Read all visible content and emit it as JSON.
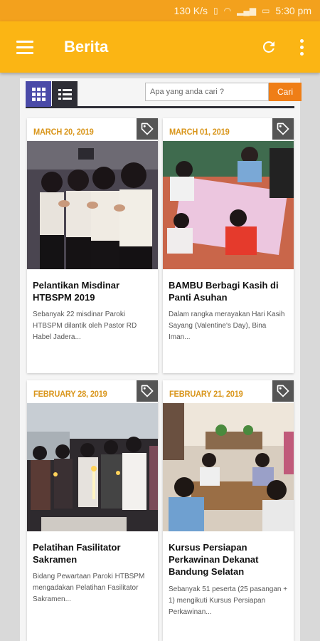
{
  "status_bar": {
    "speed": "130 K/s",
    "time": "5:30 pm"
  },
  "app_bar": {
    "title": "Berita"
  },
  "search": {
    "placeholder": "Apa yang anda cari ?",
    "button_label": "Cari"
  },
  "articles": [
    {
      "date": "MARCH 20, 2019",
      "title": "Pelantikan Misdinar HTBSPM 2019",
      "excerpt": "Sebanyak 22 misdinar Paroki HTBSPM dilantik oleh Pastor RD Habel Jadera..."
    },
    {
      "date": "MARCH 01, 2019",
      "title": "BAMBU Berbagi Kasih di Panti Asuhan",
      "excerpt": "Dalam rangka merayakan Hari Kasih Sayang (Valentine's Day), Bina Iman..."
    },
    {
      "date": "FEBRUARY 28, 2019",
      "title": "Pelatihan Fasilitator Sakramen",
      "excerpt": "Bidang Pewartaan Paroki HTBSPM mengadakan Pelatihan Fasilitator Sakramen..."
    },
    {
      "date": "FEBRUARY 21, 2019",
      "title": "Kursus Persiapan Perkawinan Dekanat Bandung Selatan",
      "excerpt": "Sebanyak 51 peserta (25 pasangan + 1) mengikuti Kursus Persiapan Perkawinan..."
    }
  ]
}
